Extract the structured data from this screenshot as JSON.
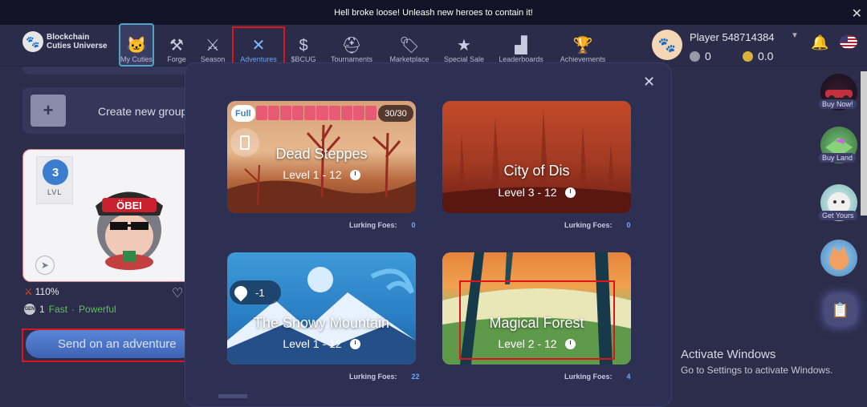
{
  "banner": {
    "text": "Hell broke loose! Unleash new heroes to contain it!"
  },
  "logo": {
    "line1": "Blockchain",
    "line2": "Cuties Universe"
  },
  "nav": {
    "items": [
      {
        "label": "My Cuties",
        "icon": "cat-face-icon"
      },
      {
        "label": "Forge",
        "icon": "anvil-icon"
      },
      {
        "label": "Season",
        "icon": "sword-icon"
      },
      {
        "label": "Adventures",
        "icon": "crossed-swords-icon"
      },
      {
        "label": "$BCUG",
        "icon": "token-chart-icon"
      },
      {
        "label": "Tournaments",
        "icon": "helmet-icon"
      },
      {
        "label": "Marketplace",
        "icon": "tag-icon"
      },
      {
        "label": "Special Sale",
        "icon": "star-icon"
      },
      {
        "label": "Leaderboards",
        "icon": "podium-icon"
      },
      {
        "label": "Achievements",
        "icon": "trophy-icon"
      }
    ],
    "active": "Adventures"
  },
  "player": {
    "name": "Player 548714384",
    "balance1": "0",
    "balance2": "0.0"
  },
  "left": {
    "create_group": "Create new group",
    "cutie": {
      "level": "3",
      "level_word": "LVL",
      "cap_text": "ÖBEI"
    },
    "stat_percent": "110%",
    "gen": "GEN",
    "gen_value": "1",
    "trait1": "Fast",
    "separator": "·",
    "trait2": "Powerful",
    "send_button": "Send on an adventure"
  },
  "modal": {
    "close": "✕",
    "foes_label": "Lurking Foes:",
    "adventures": [
      {
        "name": "Dead Steppes",
        "level": "Level 1 - 12",
        "foes": "0",
        "badge": "Full",
        "count": "30/30"
      },
      {
        "name": "City of Dis",
        "level": "Level 3 - 12",
        "foes": "0"
      },
      {
        "name": "The Snowy Mountain",
        "level": "Level 1 - 12",
        "foes": "22",
        "drop": "-1"
      },
      {
        "name": "Magical Forest",
        "level": "Level 2 - 12",
        "foes": "4"
      }
    ]
  },
  "right": {
    "items": [
      {
        "label": "Buy Now!"
      },
      {
        "label": "Buy Land"
      },
      {
        "label": "Get Yours"
      }
    ]
  },
  "windows": {
    "line1": "Activate Windows",
    "line2": "Go to Settings to activate Windows."
  },
  "colors": {
    "accent": "#6aa8ff",
    "highlight": "#e0131b",
    "background": "#2b2d4a"
  }
}
